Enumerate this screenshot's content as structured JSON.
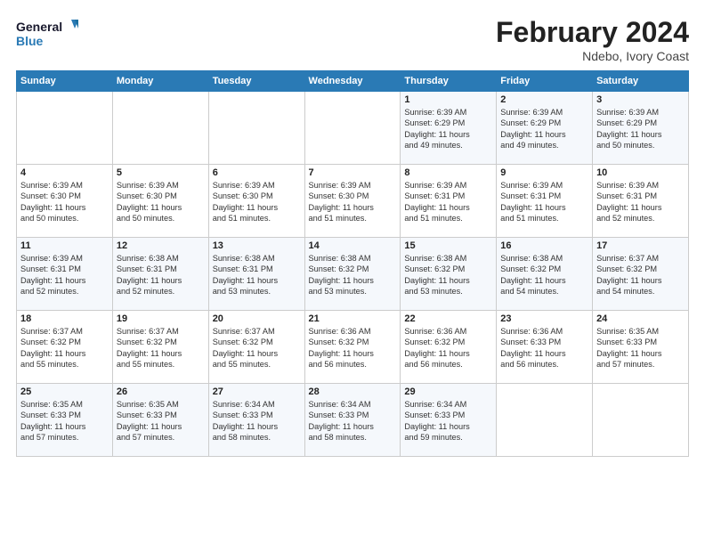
{
  "header": {
    "logo_general": "General",
    "logo_blue": "Blue",
    "month_year": "February 2024",
    "location": "Ndebo, Ivory Coast"
  },
  "weekdays": [
    "Sunday",
    "Monday",
    "Tuesday",
    "Wednesday",
    "Thursday",
    "Friday",
    "Saturday"
  ],
  "weeks": [
    [
      {
        "day": "",
        "info": ""
      },
      {
        "day": "",
        "info": ""
      },
      {
        "day": "",
        "info": ""
      },
      {
        "day": "",
        "info": ""
      },
      {
        "day": "1",
        "info": "Sunrise: 6:39 AM\nSunset: 6:29 PM\nDaylight: 11 hours\nand 49 minutes."
      },
      {
        "day": "2",
        "info": "Sunrise: 6:39 AM\nSunset: 6:29 PM\nDaylight: 11 hours\nand 49 minutes."
      },
      {
        "day": "3",
        "info": "Sunrise: 6:39 AM\nSunset: 6:29 PM\nDaylight: 11 hours\nand 50 minutes."
      }
    ],
    [
      {
        "day": "4",
        "info": "Sunrise: 6:39 AM\nSunset: 6:30 PM\nDaylight: 11 hours\nand 50 minutes."
      },
      {
        "day": "5",
        "info": "Sunrise: 6:39 AM\nSunset: 6:30 PM\nDaylight: 11 hours\nand 50 minutes."
      },
      {
        "day": "6",
        "info": "Sunrise: 6:39 AM\nSunset: 6:30 PM\nDaylight: 11 hours\nand 51 minutes."
      },
      {
        "day": "7",
        "info": "Sunrise: 6:39 AM\nSunset: 6:30 PM\nDaylight: 11 hours\nand 51 minutes."
      },
      {
        "day": "8",
        "info": "Sunrise: 6:39 AM\nSunset: 6:31 PM\nDaylight: 11 hours\nand 51 minutes."
      },
      {
        "day": "9",
        "info": "Sunrise: 6:39 AM\nSunset: 6:31 PM\nDaylight: 11 hours\nand 51 minutes."
      },
      {
        "day": "10",
        "info": "Sunrise: 6:39 AM\nSunset: 6:31 PM\nDaylight: 11 hours\nand 52 minutes."
      }
    ],
    [
      {
        "day": "11",
        "info": "Sunrise: 6:39 AM\nSunset: 6:31 PM\nDaylight: 11 hours\nand 52 minutes."
      },
      {
        "day": "12",
        "info": "Sunrise: 6:38 AM\nSunset: 6:31 PM\nDaylight: 11 hours\nand 52 minutes."
      },
      {
        "day": "13",
        "info": "Sunrise: 6:38 AM\nSunset: 6:31 PM\nDaylight: 11 hours\nand 53 minutes."
      },
      {
        "day": "14",
        "info": "Sunrise: 6:38 AM\nSunset: 6:32 PM\nDaylight: 11 hours\nand 53 minutes."
      },
      {
        "day": "15",
        "info": "Sunrise: 6:38 AM\nSunset: 6:32 PM\nDaylight: 11 hours\nand 53 minutes."
      },
      {
        "day": "16",
        "info": "Sunrise: 6:38 AM\nSunset: 6:32 PM\nDaylight: 11 hours\nand 54 minutes."
      },
      {
        "day": "17",
        "info": "Sunrise: 6:37 AM\nSunset: 6:32 PM\nDaylight: 11 hours\nand 54 minutes."
      }
    ],
    [
      {
        "day": "18",
        "info": "Sunrise: 6:37 AM\nSunset: 6:32 PM\nDaylight: 11 hours\nand 55 minutes."
      },
      {
        "day": "19",
        "info": "Sunrise: 6:37 AM\nSunset: 6:32 PM\nDaylight: 11 hours\nand 55 minutes."
      },
      {
        "day": "20",
        "info": "Sunrise: 6:37 AM\nSunset: 6:32 PM\nDaylight: 11 hours\nand 55 minutes."
      },
      {
        "day": "21",
        "info": "Sunrise: 6:36 AM\nSunset: 6:32 PM\nDaylight: 11 hours\nand 56 minutes."
      },
      {
        "day": "22",
        "info": "Sunrise: 6:36 AM\nSunset: 6:32 PM\nDaylight: 11 hours\nand 56 minutes."
      },
      {
        "day": "23",
        "info": "Sunrise: 6:36 AM\nSunset: 6:33 PM\nDaylight: 11 hours\nand 56 minutes."
      },
      {
        "day": "24",
        "info": "Sunrise: 6:35 AM\nSunset: 6:33 PM\nDaylight: 11 hours\nand 57 minutes."
      }
    ],
    [
      {
        "day": "25",
        "info": "Sunrise: 6:35 AM\nSunset: 6:33 PM\nDaylight: 11 hours\nand 57 minutes."
      },
      {
        "day": "26",
        "info": "Sunrise: 6:35 AM\nSunset: 6:33 PM\nDaylight: 11 hours\nand 57 minutes."
      },
      {
        "day": "27",
        "info": "Sunrise: 6:34 AM\nSunset: 6:33 PM\nDaylight: 11 hours\nand 58 minutes."
      },
      {
        "day": "28",
        "info": "Sunrise: 6:34 AM\nSunset: 6:33 PM\nDaylight: 11 hours\nand 58 minutes."
      },
      {
        "day": "29",
        "info": "Sunrise: 6:34 AM\nSunset: 6:33 PM\nDaylight: 11 hours\nand 59 minutes."
      },
      {
        "day": "",
        "info": ""
      },
      {
        "day": "",
        "info": ""
      }
    ]
  ]
}
